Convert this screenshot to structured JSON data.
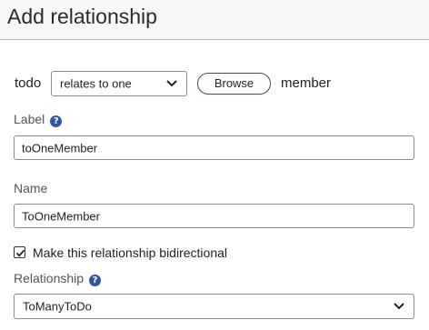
{
  "dialog": {
    "title": "Add relationship"
  },
  "relation": {
    "from_entity": "todo",
    "type_selected": "relates to one",
    "browse_label": "Browse",
    "to_entity": "member"
  },
  "label_field": {
    "label": "Label",
    "help": "?",
    "value": "toOneMember"
  },
  "name_field": {
    "label": "Name",
    "value": "ToOneMember"
  },
  "bidirectional": {
    "label": "Make this relationship bidirectional",
    "checked": true
  },
  "relationship_field": {
    "label": "Relationship",
    "help": "?",
    "selected": "ToManyToDo"
  },
  "icons": {
    "dropdown": "chevron-down-icon",
    "help": "question-circle-icon",
    "check": "checkmark-icon"
  },
  "colors": {
    "accent": "#2f55a4",
    "border": "#8c8c8c",
    "title_bar": "#f7f7f7"
  }
}
